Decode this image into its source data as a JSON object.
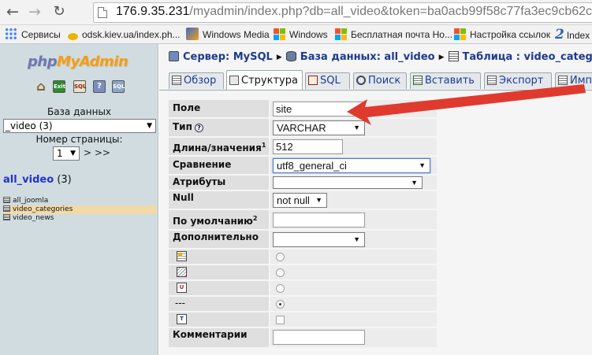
{
  "browser": {
    "url_host": "176.9.35.231",
    "url_rest": "/myadmin/index.php?db=all_video&token=ba0acb99f58c77fa3ec9cb62c",
    "bookmarks": [
      {
        "label": "Сервисы",
        "icon": "apps-icon"
      },
      {
        "label": "odsk.kiev.ua/index.ph...",
        "icon": "odsk-favicon"
      },
      {
        "label": "Windows Media",
        "icon": "windows-media-favicon"
      },
      {
        "label": "Windows",
        "icon": "windows-logo-icon"
      },
      {
        "label": "Бесплатная почта Ho...",
        "icon": "windows-logo-icon"
      },
      {
        "label": "Настройка ссылок",
        "icon": "windows-logo-icon"
      },
      {
        "label": "Index",
        "icon": "two-favicon"
      }
    ]
  },
  "sidebar": {
    "logo": {
      "php": "php",
      "my": "My",
      "admin": "Admin"
    },
    "db_label": "База данных",
    "db_selected": "_video (3)",
    "page_label": "Номер страницы:",
    "page_selected": "1",
    "page_nav": "> >>",
    "db_link": "all_video",
    "db_count": "(3)",
    "tables": [
      {
        "name": "all_joomla",
        "active": false
      },
      {
        "name": "video_categories",
        "active": true
      },
      {
        "name": "video_news",
        "active": false
      }
    ]
  },
  "breadcrumb": {
    "server": "Сервер: MySQL",
    "database": "База данных: all_video",
    "table": "Таблица : video_categories"
  },
  "tabs": {
    "browse": "Обзор",
    "structure": "Структура",
    "sql": "SQL",
    "search": "Поиск",
    "insert": "Вставить",
    "export": "Экспорт",
    "import": "Имп"
  },
  "form": {
    "field_label": "Поле",
    "field_value": "site",
    "type_label": "Тип",
    "type_value": "VARCHAR",
    "length_label": "Длина/значения",
    "length_sup": "1",
    "length_value": "512",
    "collation_label": "Сравнение",
    "collation_value": "utf8_general_ci",
    "attributes_label": "Атрибуты",
    "attributes_value": "",
    "null_label": "Null",
    "null_value": "not null",
    "default_label": "По умолчанию",
    "default_sup": "2",
    "default_value": "",
    "extra_label": "Дополнительно",
    "extra_value": "",
    "none_label": "---",
    "index_choice": "none",
    "fulltext_checked": false,
    "comments_label": "Комментарии",
    "comments_value": ""
  },
  "colors": {
    "sidebar_bg": "#d0dce0",
    "link": "#1d3a8f",
    "annotation_arrow": "#e03a2f"
  }
}
